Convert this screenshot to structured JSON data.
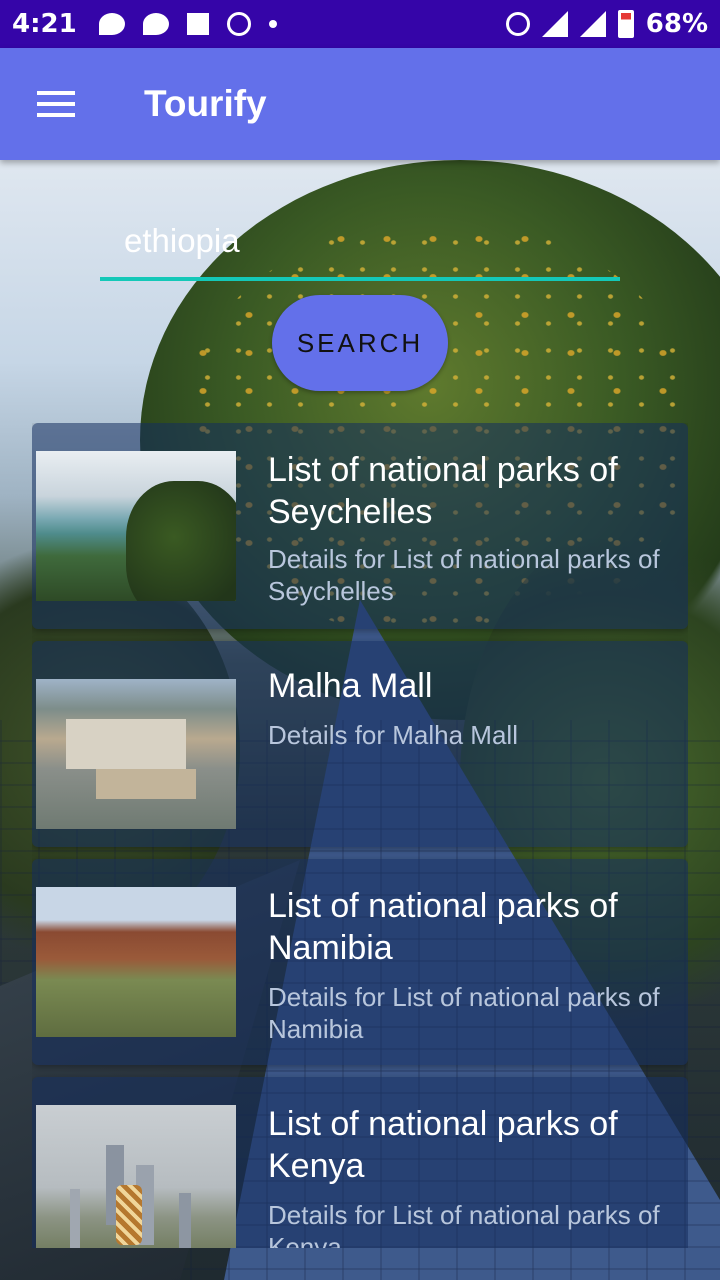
{
  "status_bar": {
    "time": "4:21",
    "battery": "68%"
  },
  "app_bar": {
    "title": "Tourify"
  },
  "search": {
    "value": "ethiopia",
    "button_label": "SEARCH"
  },
  "results": [
    {
      "title": "List of national parks of Seychelles",
      "description": "Details for List of national parks of Seychelles"
    },
    {
      "title": "Malha Mall",
      "description": "Details for Malha Mall"
    },
    {
      "title": "List of national parks of Namibia",
      "description": "Details for List of national parks of Namibia"
    },
    {
      "title": "List of national parks of Kenya",
      "description": "Details for List of national parks of Kenya"
    }
  ],
  "colors": {
    "status_bar": "#3505a8",
    "app_bar": "#6370ea",
    "search_underline": "#14c8b8"
  }
}
